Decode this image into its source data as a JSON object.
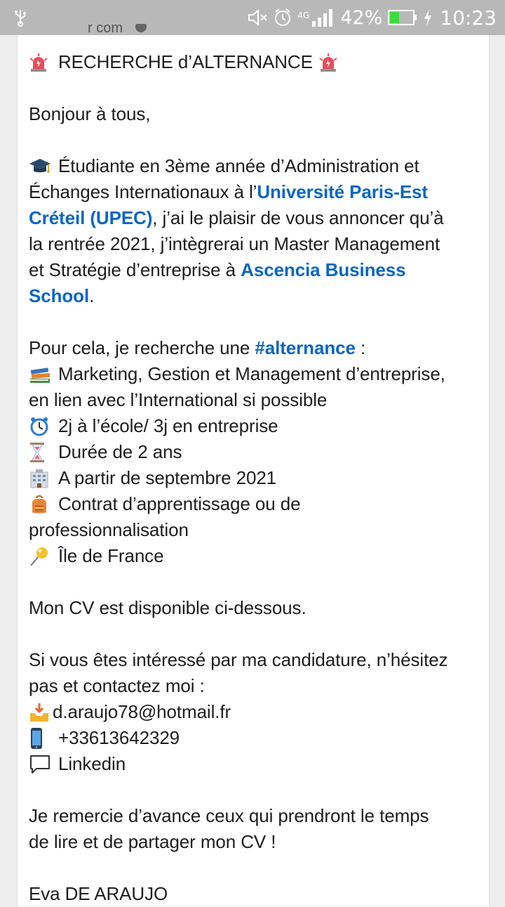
{
  "status_bar": {
    "network": "4G",
    "battery_percent": "42%",
    "time": "10:23",
    "battery_level": 0.42
  },
  "post": {
    "author_fragment": "r com",
    "heading": "RECHERCHE d’ALTERNANCE",
    "greeting": "Bonjour à tous,",
    "intro_1": "Étudiante en 3ème année d’Administration et",
    "intro_2_a": "Échanges Internationaux à l’",
    "upec_link_1": "Université Paris-Est",
    "upec_link_2": "Créteil (UPEC)",
    "intro_3_b": ", j’ai le plaisir de vous annoncer qu’à",
    "intro_4": "la rentrée 2021, j’intègrerai un Master Management",
    "intro_5_a": "et Stratégie d’entreprise à ",
    "school_link_1": "Ascencia Business",
    "school_link_2": "School",
    "intro_6_b": ".",
    "search_a": "Pour cela, je recherche une ",
    "hashtag": "#alternance",
    "search_b": " :",
    "field_1": "Marketing, Gestion et Management d’entreprise,",
    "field_2": "en lien avec l’International si possible",
    "rhythm": "2j à l’école/ 3j en entreprise",
    "duration": "Durée de 2 ans",
    "start": "A partir de septembre 2021",
    "contract_1": "Contrat d’apprentissage ou de",
    "contract_2": "professionnalisation",
    "location": "Île de France",
    "cv": "Mon CV est disponible ci-dessous.",
    "contact_1": "Si vous êtes intéressé par ma candidature, n’hésitez",
    "contact_2": "pas et contactez moi :",
    "email": "d.araujo78@hotmail.fr",
    "phone": "+33613642329",
    "linkedin": "Linkedin",
    "thanks_1": "Je remercie d’avance ceux qui prendront le temps",
    "thanks_2": "de lire et de partager mon CV !",
    "signature": "Eva DE ARAUJO"
  },
  "colors": {
    "link": "#0a66c2",
    "text": "#1d1d1d",
    "status_bar": "#b8b8b8",
    "battery_fill": "#3ddc3d"
  },
  "icons": {
    "heading": "rotating-light-icon",
    "intro": "graduation-cap-icon",
    "field": "books-icon",
    "rhythm": "alarm-clock-icon",
    "duration": "hourglass-icon",
    "start": "office-building-icon",
    "contract": "backpack-icon",
    "location": "round-pushpin-icon",
    "email": "inbox-tray-icon",
    "phone": "mobile-phone-icon",
    "linkedin": "speech-balloon-icon"
  }
}
